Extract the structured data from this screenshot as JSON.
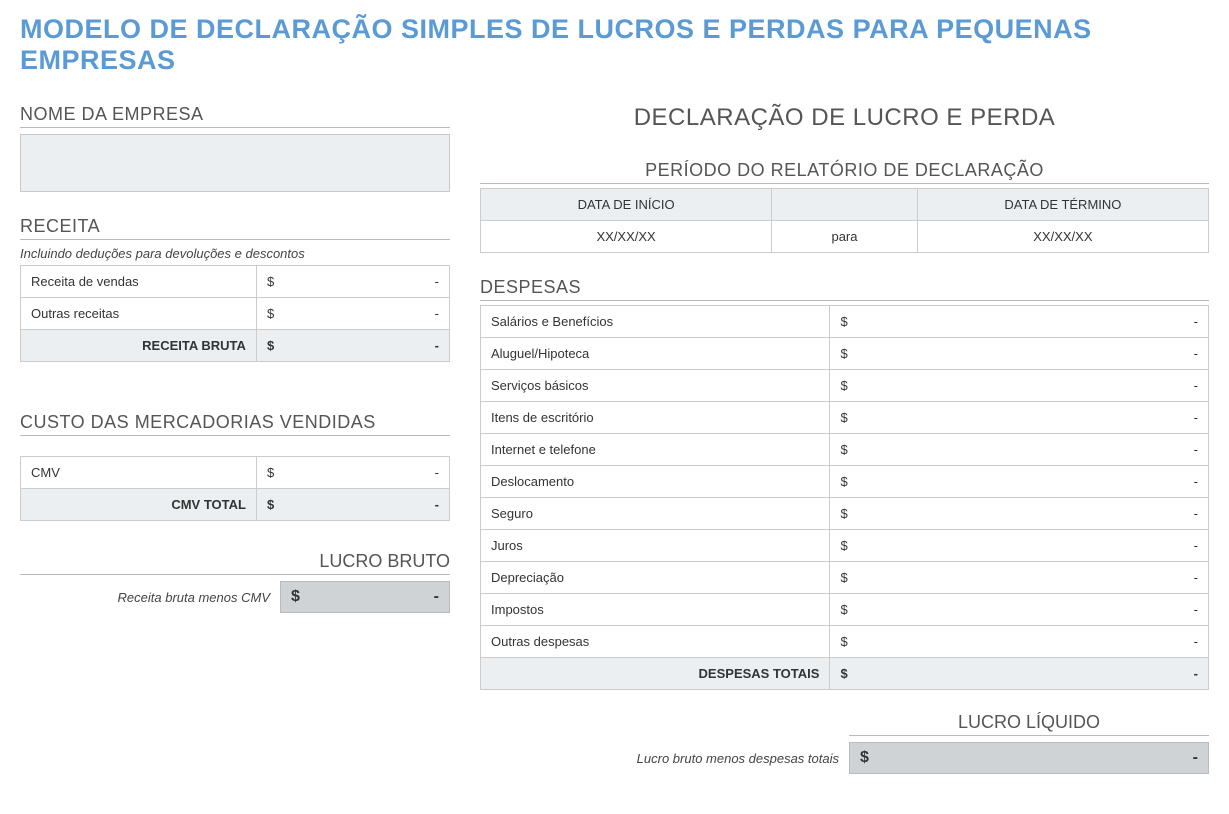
{
  "main_title": "MODELO DE DECLARAÇÃO SIMPLES DE LUCROS E PERDAS PARA PEQUENAS EMPRESAS",
  "doc_title": "DECLARAÇÃO DE LUCRO E PERDA",
  "company": {
    "label": "NOME DA EMPRESA",
    "value": ""
  },
  "period": {
    "label": "PERÍODO DO RELATÓRIO DE DECLARAÇÃO",
    "start_label": "DATA DE INÍCIO",
    "end_label": "DATA DE TÉRMINO",
    "start_value": "XX/XX/XX",
    "separator": "para",
    "end_value": "XX/XX/XX"
  },
  "revenue": {
    "title": "RECEITA",
    "subtitle": "Incluindo deduções para devoluções e descontos",
    "currency": "$",
    "rows": [
      {
        "label": "Receita de vendas",
        "value": "-"
      },
      {
        "label": "Outras receitas",
        "value": "-"
      }
    ],
    "total_label": "RECEITA BRUTA",
    "total_value": "-"
  },
  "cogs": {
    "title": "CUSTO DAS MERCADORIAS VENDIDAS",
    "currency": "$",
    "rows": [
      {
        "label": "CMV",
        "value": "-"
      }
    ],
    "total_label": "CMV TOTAL",
    "total_value": "-"
  },
  "gross_profit": {
    "title": "LUCRO BRUTO",
    "desc": "Receita bruta menos CMV",
    "currency": "$",
    "value": "-"
  },
  "expenses": {
    "title": "DESPESAS",
    "currency": "$",
    "rows": [
      {
        "label": "Salários e Benefícios",
        "value": "-"
      },
      {
        "label": "Aluguel/Hipoteca",
        "value": "-"
      },
      {
        "label": "Serviços básicos",
        "value": "-"
      },
      {
        "label": "Itens de escritório",
        "value": "-"
      },
      {
        "label": "Internet e telefone",
        "value": "-"
      },
      {
        "label": "Deslocamento",
        "value": "-"
      },
      {
        "label": "Seguro",
        "value": "-"
      },
      {
        "label": "Juros",
        "value": "-"
      },
      {
        "label": "Depreciação",
        "value": "-"
      },
      {
        "label": "Impostos",
        "value": "-"
      },
      {
        "label": "Outras despesas",
        "value": "-"
      }
    ],
    "total_label": "DESPESAS TOTAIS",
    "total_value": "-"
  },
  "net": {
    "title": "LUCRO LÍQUIDO",
    "desc": "Lucro bruto menos despesas totais",
    "currency": "$",
    "value": "-"
  }
}
